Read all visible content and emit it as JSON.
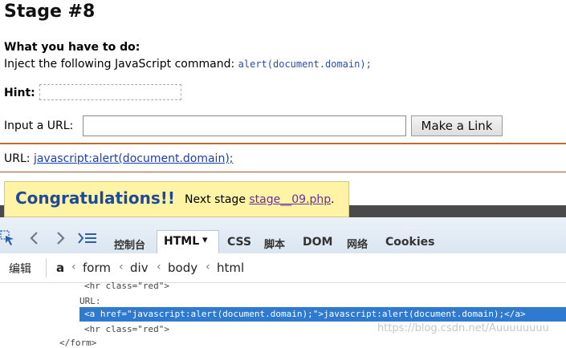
{
  "page": {
    "title": "Stage #8",
    "todo_heading": "What you have to do:",
    "instruction_text": "Inject the following JavaScript command:",
    "instruction_code": "alert(document.domain);",
    "hint_label": "Hint:",
    "url_input_label": "Input a URL:",
    "url_input_value": "",
    "make_link_button": "Make a Link",
    "url_result_label": "URL:",
    "url_result_link": "javascript:alert(document.domain);",
    "congrats_title": "Congratulations!!",
    "next_stage_text": "Next stage",
    "next_stage_link": "stage__09.php",
    "next_stage_period": "."
  },
  "devtools": {
    "tabs": [
      "控制台",
      "HTML",
      "CSS",
      "脚本",
      "DOM",
      "网络",
      "Cookies"
    ],
    "html_tab_arrow": "▾",
    "edit_button": "编辑",
    "breadcrumbs": [
      "a",
      "form",
      "div",
      "body",
      "html"
    ],
    "source": {
      "line1": "<hr class=\"red\">",
      "line2": "URL:",
      "line3": "<a href=\"javascript:alert(document.domain);\">javascript:alert(document.domain);</a>",
      "line4": "<hr class=\"red\">",
      "line5": "</form>"
    },
    "icons": [
      "inspect-icon",
      "back-icon",
      "forward-icon",
      "console-list-icon"
    ]
  },
  "watermark": "https://blog.csdn.net/Auuuuuuuu",
  "colors": {
    "link": "#1c3fae",
    "congrats_bg": "#fff3a5",
    "congrats_title": "#1d4a9a",
    "selection": "#2e7ad1",
    "hr": "#c06a2b"
  }
}
